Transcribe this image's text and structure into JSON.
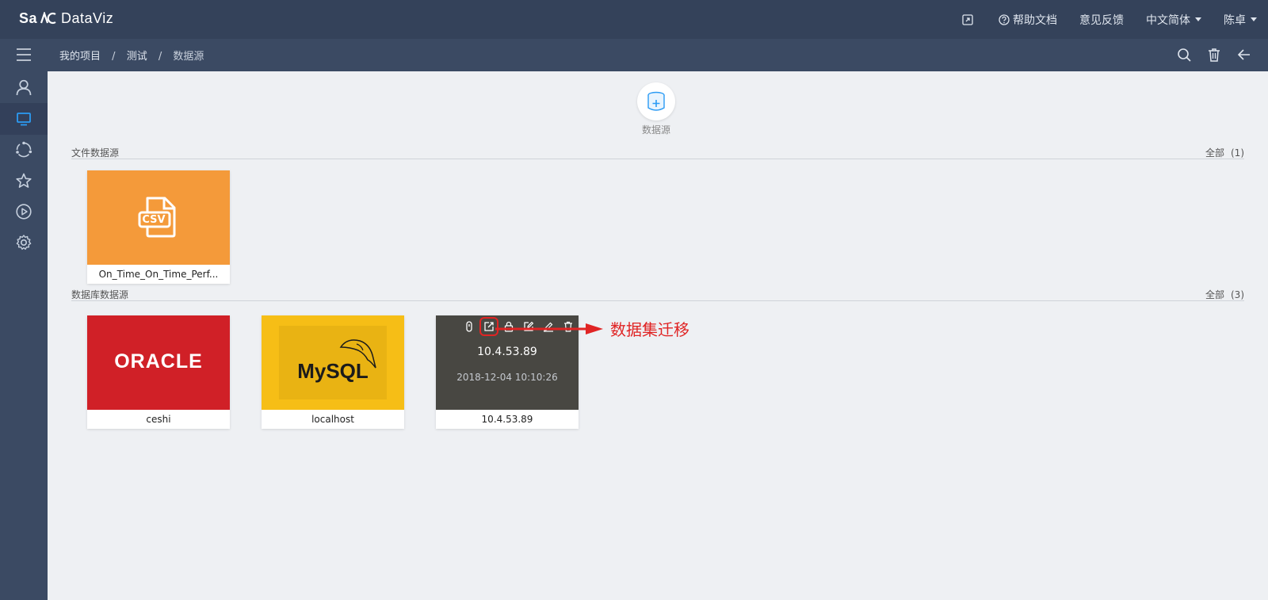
{
  "app": {
    "logo_bold": "Sa",
    "logo_rest": "DataViz",
    "logo_full": "SaCa DataViz"
  },
  "topbar": {
    "help_label": "帮助文档",
    "feedback_label": "意见反馈",
    "language_label": "中文简体",
    "user_label": "陈卓"
  },
  "breadcrumb": {
    "items": [
      "我的项目",
      "测试",
      "数据源"
    ],
    "separator": "/"
  },
  "add_datasource": {
    "label": "数据源"
  },
  "file_section": {
    "title": "文件数据源",
    "all_label": "全部",
    "count": "(1)"
  },
  "db_section": {
    "title": "数据库数据源",
    "all_label": "全部",
    "count": "(3)"
  },
  "file_cards": [
    {
      "name": "On_Time_On_Time_Perf...",
      "thumb_text": "CSV"
    }
  ],
  "db_cards": [
    {
      "name": "ceshi",
      "thumb_text": "ORACLE"
    },
    {
      "name": "localhost",
      "thumb_text": "MySQL"
    },
    {
      "name": "10.4.53.89",
      "overlay_title": "10.4.53.89",
      "overlay_date": "2018-12-04 10:10:26"
    }
  ],
  "annotation": {
    "label": "数据集迁移"
  },
  "colors": {
    "topbar": "#34425a",
    "subbar": "#3b4a63",
    "sidebar": "#3b4a63",
    "accent": "#2b9bf4",
    "csv_card": "#f49a3a",
    "oracle_card": "#d02027",
    "mysql_card": "#f6be16",
    "annotation": "#e02424"
  }
}
